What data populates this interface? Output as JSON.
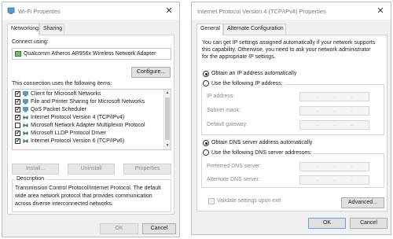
{
  "wifi_window": {
    "title": "Wi-Fi Properties",
    "tabs": [
      "Networking",
      "Sharing"
    ],
    "connect_using_label": "Connect using:",
    "adapter_name": "Qualcomm Atheros AR956x Wireless Network Adapter",
    "configure_button": "Configure...",
    "items_label": "This connection uses the following items:",
    "items": [
      {
        "label": "Client for Microsoft Networks",
        "checked": true,
        "icon": "network-client-icon"
      },
      {
        "label": "File and Printer Sharing for Microsoft Networks",
        "checked": true,
        "icon": "network-client-icon"
      },
      {
        "label": "QoS Packet Scheduler",
        "checked": true,
        "icon": "network-client-icon"
      },
      {
        "label": "Internet Protocol Version 4 (TCP/IPv4)",
        "checked": true,
        "icon": "protocol-icon"
      },
      {
        "label": "Microsoft Network Adapter Multiplexor Protocol",
        "checked": false,
        "icon": "protocol-icon"
      },
      {
        "label": "Microsoft LLDP Protocol Driver",
        "checked": true,
        "icon": "protocol-icon"
      },
      {
        "label": "Internet Protocol Version 6 (TCP/IPv6)",
        "checked": true,
        "icon": "protocol-icon"
      }
    ],
    "install_button": "Install...",
    "uninstall_button": "Uninstall",
    "properties_button": "Properties",
    "description_label": "Description",
    "description_text_1": "Transmission Control Protocol/Internet Protocol. The default",
    "description_text_2": "wide area network protocol that provides communication",
    "description_text_3": "across diverse interconnected networks.",
    "ok_button": "OK",
    "cancel_button": "Cancel",
    "close_glyph": "✕"
  },
  "ipv4_window": {
    "title": "Internet Protocol Version 4 (TCP/IPv4) Properties",
    "tabs": [
      "General",
      "Alternate Configuration"
    ],
    "intro_1": "You can get IP settings assigned automatically if your network supports",
    "intro_2": "this capability. Otherwise, you need to ask your network administrator",
    "intro_3": "for the appropriate IP settings.",
    "obtain_ip_auto": "Obtain an IP address automatically",
    "use_following_ip": "Use the following IP address:",
    "ip_address_label": "IP address:",
    "subnet_mask_label": "Subnet mask:",
    "default_gateway_label": "Default gateway:",
    "obtain_dns_auto": "Obtain DNS server address automatically",
    "use_following_dns": "Use the following DNS server addresses:",
    "preferred_dns_label": "Preferred DNS server:",
    "alternate_dns_label": "Alternate DNS server:",
    "validate_label": "Validate settings upon exit",
    "advanced_button": "Advanced...",
    "ok_button": "OK",
    "cancel_button": "Cancel",
    "close_glyph": "✕",
    "ip_dots": ".",
    "ip_selection": "obtain-automatically",
    "dns_selection": "obtain-automatically"
  }
}
